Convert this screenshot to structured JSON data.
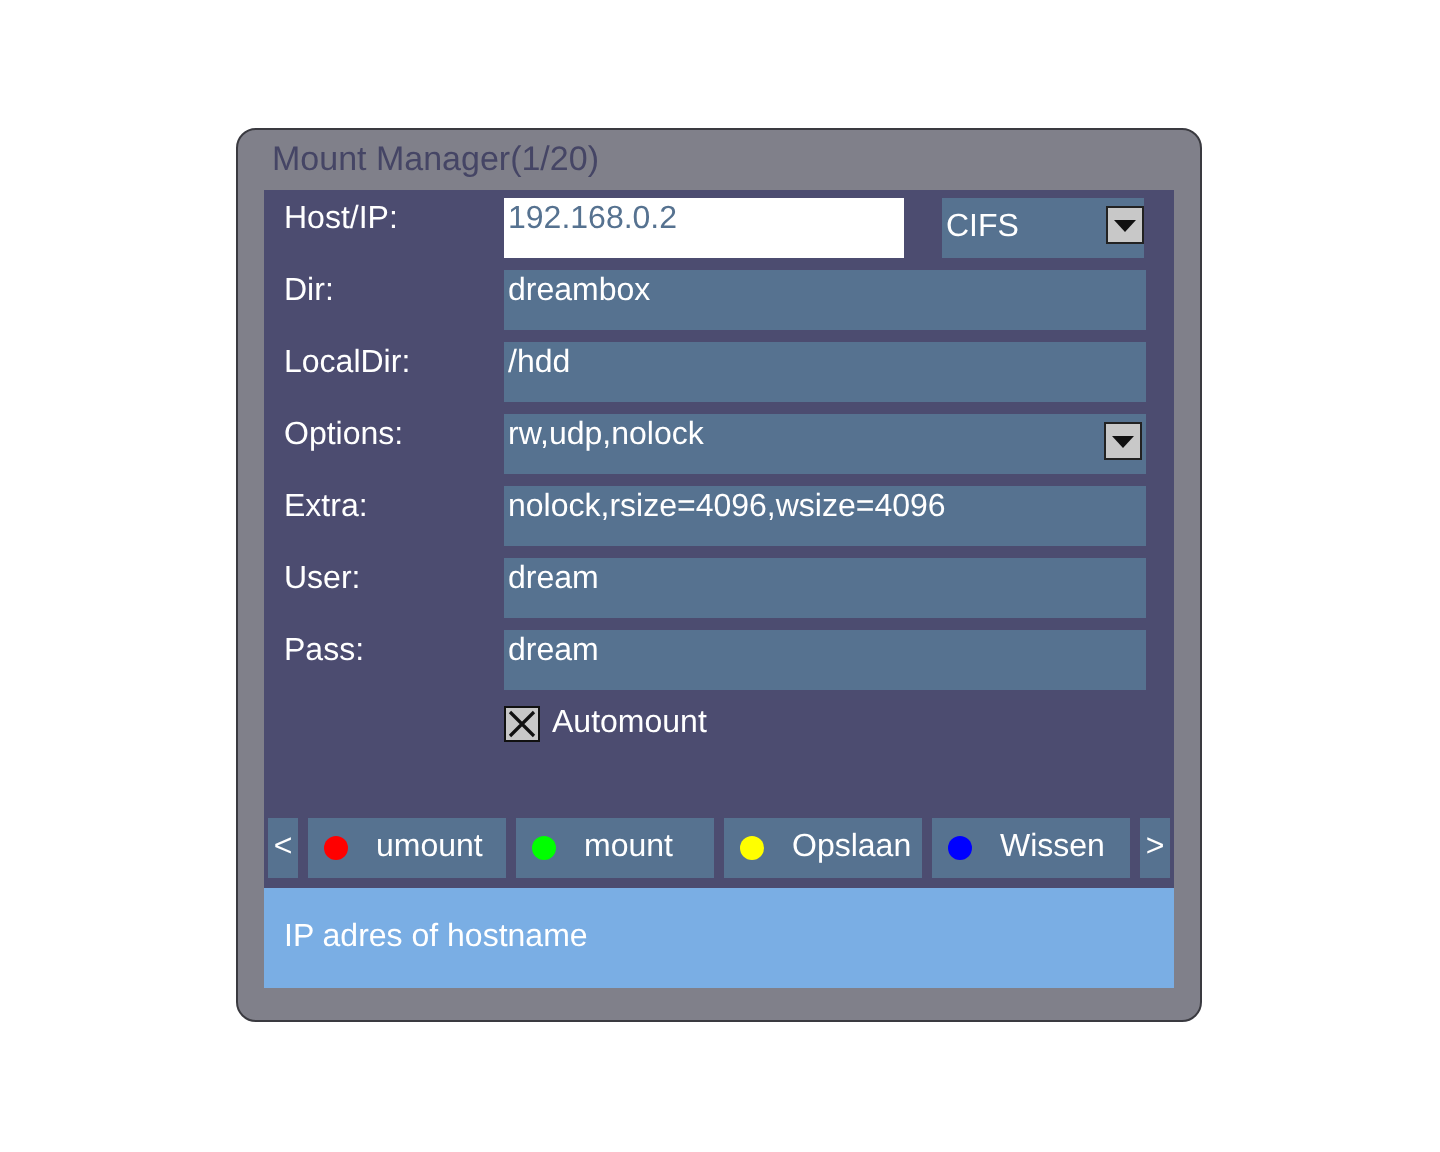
{
  "window": {
    "title": "Mount Manager(1/20)"
  },
  "fields": [
    {
      "label": "Host/IP:",
      "value": "192.168.0.2",
      "kind": "text",
      "focused": true,
      "protocol": {
        "value": "CIFS"
      }
    },
    {
      "label": "Dir:",
      "value": "dreambox",
      "kind": "text",
      "focused": false
    },
    {
      "label": "LocalDir:",
      "value": "/hdd",
      "kind": "text",
      "focused": false
    },
    {
      "label": "Options:",
      "value": "rw,udp,nolock",
      "kind": "select",
      "focused": false
    },
    {
      "label": "Extra:",
      "value": "nolock,rsize=4096,wsize=4096",
      "kind": "text",
      "focused": false
    },
    {
      "label": "User:",
      "value": "dream",
      "kind": "text",
      "focused": false
    },
    {
      "label": "Pass:",
      "value": "dream",
      "kind": "text",
      "focused": false
    }
  ],
  "automount": {
    "label": "Automount",
    "checked": true
  },
  "buttons": [
    {
      "label": "<",
      "kind": "arrow"
    },
    {
      "label": "umount",
      "kind": "color",
      "color": "#ff0000"
    },
    {
      "label": "mount",
      "kind": "color",
      "color": "#00ff00"
    },
    {
      "label": "Opslaan",
      "kind": "color",
      "color": "#ffff00"
    },
    {
      "label": "Wissen",
      "kind": "color",
      "color": "#0000ff"
    },
    {
      "label": ">",
      "kind": "arrow"
    }
  ],
  "status_bar": {
    "text": "IP adres of hostname"
  }
}
